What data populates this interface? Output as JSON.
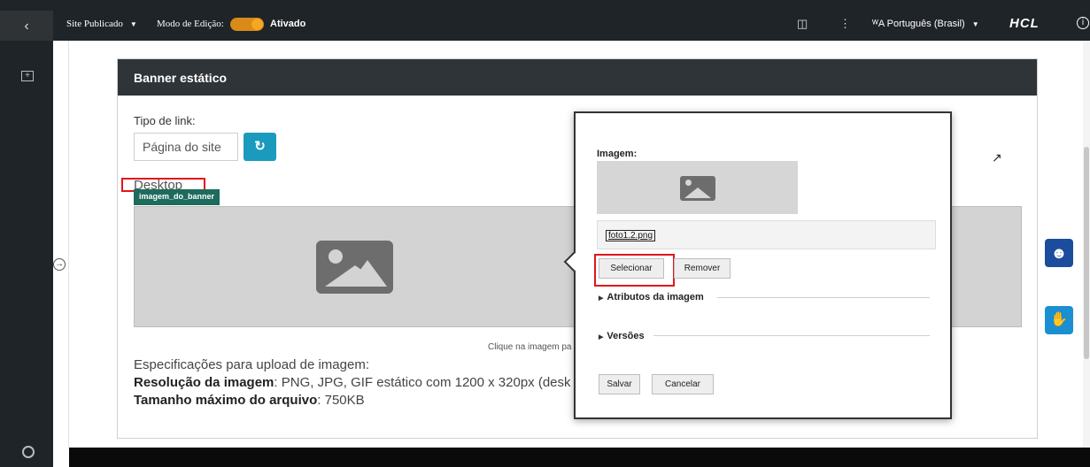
{
  "topbar": {
    "back_icon": "chevron-left-icon",
    "site_label": "Site Publicado",
    "mode_label": "Modo de Edição:",
    "mode_state": "Ativado",
    "language": "Português (Brasil)",
    "brand": "HCL"
  },
  "panel": {
    "title": "Banner estático",
    "link_type_label": "Tipo de link:",
    "link_type_value": "Página do site",
    "desktop_label": "Desktop",
    "image_tag": "imagem_do_banner",
    "click_hint": "Clique na imagem pa",
    "spec_intro": "Especificações para upload de imagem:",
    "spec_resolution_label": "Resolução da imagem",
    "spec_resolution_value": ": PNG, JPG, GIF estático com 1200 x 320px (desk",
    "spec_size_label": "Tamanho máximo do arquivo",
    "spec_size_value": ": 750KB"
  },
  "modal": {
    "image_label": "Imagem:",
    "file_name": "foto1.2.png",
    "select_button": "Selecionar",
    "remove_button": "Remover",
    "section_attributes": "Atributos da imagem",
    "section_versions": "Versões",
    "save_button": "Salvar",
    "cancel_button": "Cancelar"
  },
  "colors": {
    "dark_bar": "#1f2428",
    "accent_toggle": "#d98a18",
    "refresh_button": "#1a9bbd",
    "tag_green": "#1c6b5c",
    "highlight_red": "#e0161b"
  }
}
